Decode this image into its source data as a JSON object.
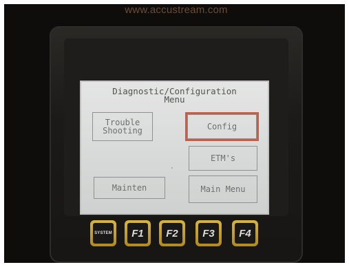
{
  "watermark": "www.accustream.com",
  "screen": {
    "title": "Diagnostic/Configuration\nMenu",
    "buttons": {
      "trouble_shooting": "Trouble\nShooting",
      "config": "Config",
      "etms": "ETM's",
      "mainten": "Mainten",
      "main_menu": "Main Menu"
    }
  },
  "keys": {
    "system": "SYSTEM",
    "f1": "F1",
    "f2": "F2",
    "f3": "F3",
    "f4": "F4"
  },
  "colors": {
    "highlight": "#d6563f",
    "key_gold": "#c9a233"
  }
}
